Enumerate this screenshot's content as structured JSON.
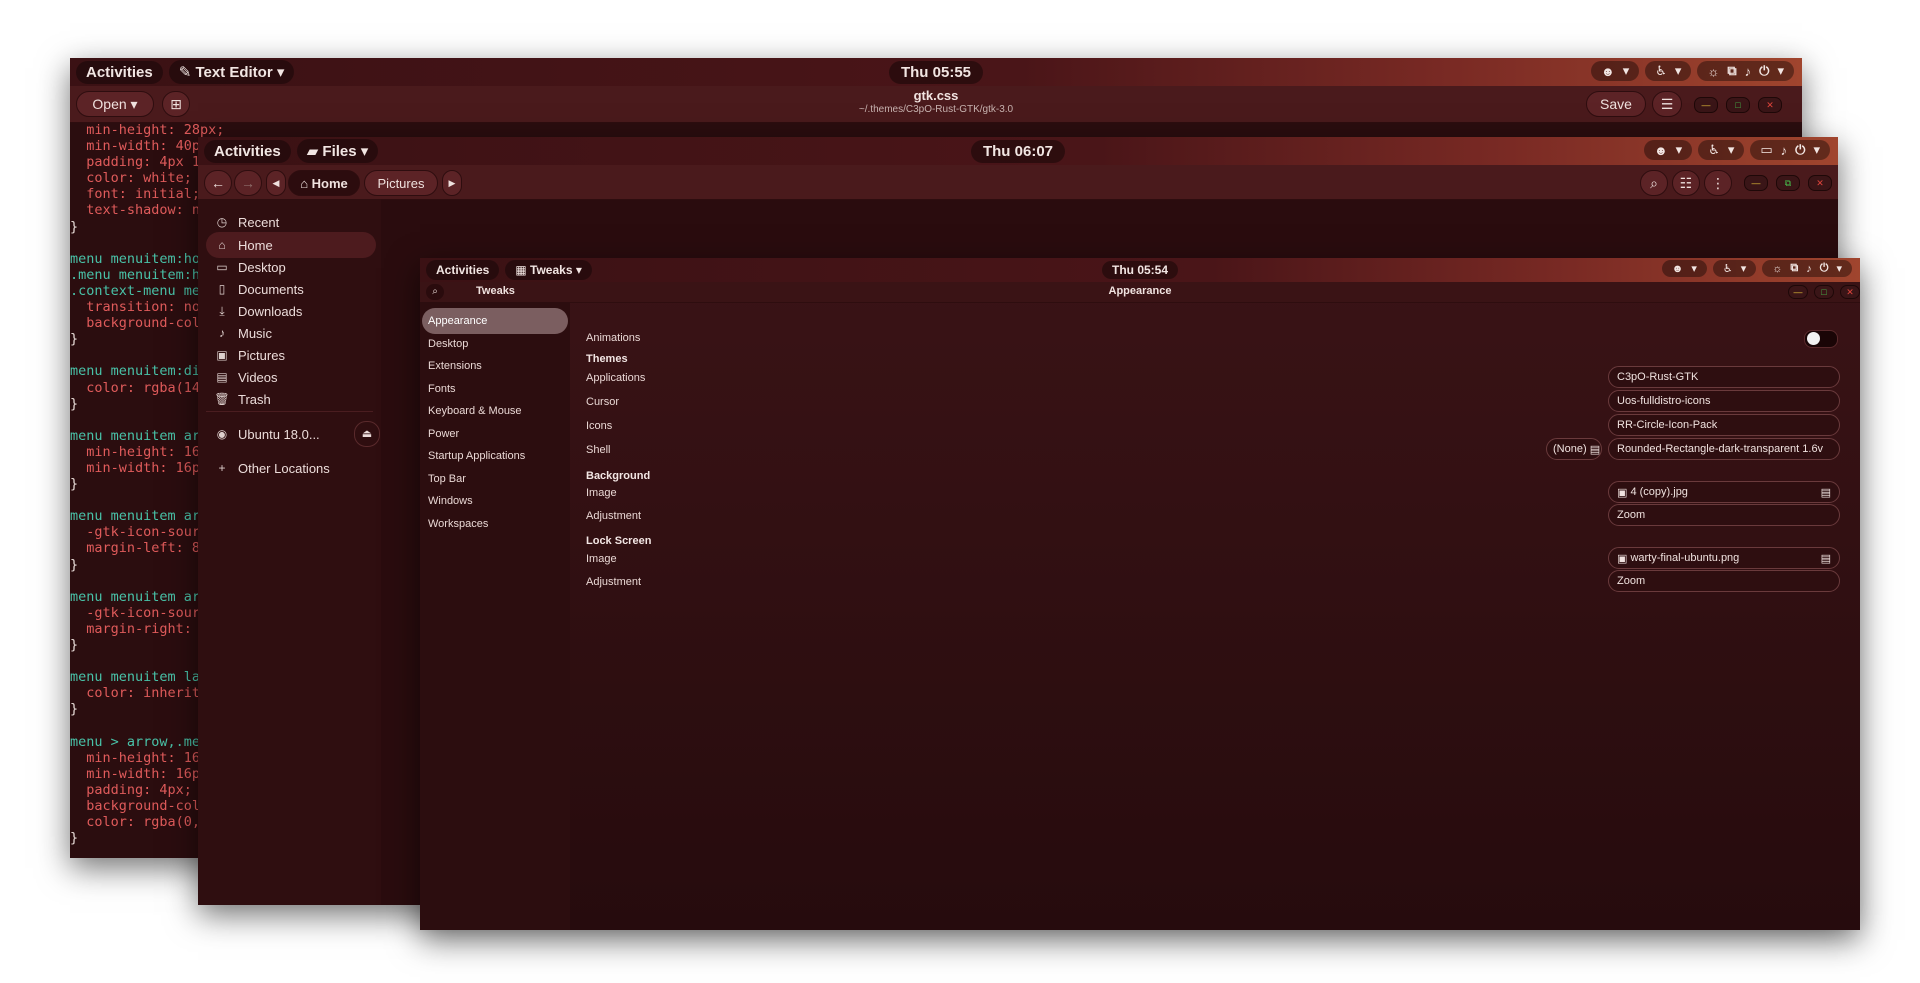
{
  "editor": {
    "topbar": {
      "activities": "Activities",
      "app": "Text Editor",
      "clock": "Thu 05:55"
    },
    "open_label": "Open",
    "title": "gtk.css",
    "subtitle": "~/.themes/C3pO-Rust-GTK/gtk-3.0",
    "save_label": "Save",
    "code_lines": [
      "  min-height: 28px;",
      "  min-width: 40p",
      "  padding: 4px 1",
      "  color: white;",
      "  font: initial;",
      "  text-shadow: n",
      "}",
      "",
      "menu menuitem:ho",
      ".menu menuitem:h",
      ".context-menu me",
      "  transition: no",
      "  background-col",
      "}",
      "",
      "menu menuitem:di",
      "  color: rgba(14",
      "}",
      "",
      "menu menuitem ar",
      "  min-height: 16",
      "  min-width: 16p",
      "}",
      "",
      "menu menuitem ar",
      "  -gtk-icon-sour",
      "  margin-left: 8",
      "}",
      "",
      "menu menuitem ar",
      "  -gtk-icon-sour",
      "  margin-right: ",
      "}",
      "",
      "menu menuitem la",
      "  color: inherit",
      "}",
      "",
      "menu > arrow,.me",
      "  min-height: 16",
      "  min-width: 16p",
      "  padding: 4px;",
      "  background-col",
      "  color: rgba(0,",
      "}"
    ]
  },
  "files": {
    "topbar": {
      "activities": "Activities",
      "app": "Files",
      "clock": "Thu 06:07"
    },
    "path": [
      "Home",
      "Pictures"
    ],
    "sidebar": [
      {
        "icon": "clock-icon",
        "glyph": "◷",
        "label": "Recent"
      },
      {
        "icon": "home-icon",
        "glyph": "⌂",
        "label": "Home"
      },
      {
        "icon": "desktop-icon",
        "glyph": "▭",
        "label": "Desktop"
      },
      {
        "icon": "document-icon",
        "glyph": "▯",
        "label": "Documents"
      },
      {
        "icon": "download-icon",
        "glyph": "⤓",
        "label": "Downloads"
      },
      {
        "icon": "music-icon",
        "glyph": "♪",
        "label": "Music"
      },
      {
        "icon": "pictures-icon",
        "glyph": "▣",
        "label": "Pictures"
      },
      {
        "icon": "videos-icon",
        "glyph": "▤",
        "label": "Videos"
      },
      {
        "icon": "trash-icon",
        "glyph": "🗑",
        "label": "Trash"
      },
      {
        "icon": "disk-icon",
        "glyph": "◉",
        "label": "Ubuntu 18.0..."
      },
      {
        "icon": "plus-icon",
        "glyph": "+",
        "label": "Other Locations"
      }
    ]
  },
  "tweaks": {
    "topbar": {
      "activities": "Activities",
      "app": "Tweaks",
      "clock": "Thu 05:54"
    },
    "header_app": "Tweaks",
    "header_title": "Appearance",
    "sidebar": [
      "Appearance",
      "Desktop",
      "Extensions",
      "Fonts",
      "Keyboard & Mouse",
      "Power",
      "Startup Applications",
      "Top Bar",
      "Windows",
      "Workspaces"
    ],
    "animations_label": "Animations",
    "animations_on": false,
    "themes": {
      "title": "Themes",
      "applications_label": "Applications",
      "applications_value": "C3pO-Rust-GTK",
      "cursor_label": "Cursor",
      "cursor_value": "Uos-fulldistro-icons",
      "icons_label": "Icons",
      "icons_value": "RR-Circle-Icon-Pack",
      "shell_label": "Shell",
      "shell_none": "(None)",
      "shell_value": "Rounded-Rectangle-dark-transparent 1.6v"
    },
    "background": {
      "title": "Background",
      "image_label": "Image",
      "image_value": "4 (copy).jpg",
      "adjustment_label": "Adjustment",
      "adjustment_value": "Zoom"
    },
    "lock_screen": {
      "title": "Lock Screen",
      "image_label": "Image",
      "image_value": "warty-final-ubuntu.png",
      "adjustment_label": "Adjustment",
      "adjustment_value": "Zoom"
    }
  }
}
